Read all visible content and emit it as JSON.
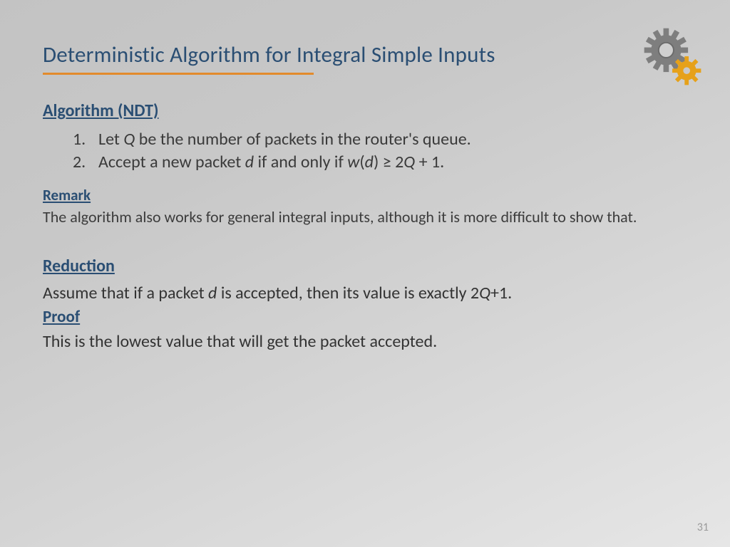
{
  "title": "Deterministic Algorithm for Integral Simple Inputs",
  "algorithm": {
    "heading": "Algorithm (NDT)",
    "steps": {
      "s1_num": "1.",
      "s1_a": "Let ",
      "s1_Q": "Q",
      "s1_b": " be the number of packets in the router's queue.",
      "s2_num": "2.",
      "s2_a": "Accept a new packet ",
      "s2_d": "d",
      "s2_b": " if and only if ",
      "s2_w": "w",
      "s2_lp": "(",
      "s2_d2": "d",
      "s2_rp": ") ≥ 2",
      "s2_Q": "Q",
      "s2_tail": " + 1."
    }
  },
  "remark": {
    "heading": "Remark",
    "body": "The algorithm also works for general integral inputs, although it is more difficult to show that."
  },
  "reduction": {
    "heading": "Reduction",
    "a": "Assume that if a packet ",
    "d": "d",
    "b": " is accepted, then its value is exactly 2",
    "Q": "Q",
    "tail": "+1."
  },
  "proof": {
    "heading": "Proof",
    "body": "This is the lowest value that will get the packet accepted."
  },
  "page_number": "31"
}
